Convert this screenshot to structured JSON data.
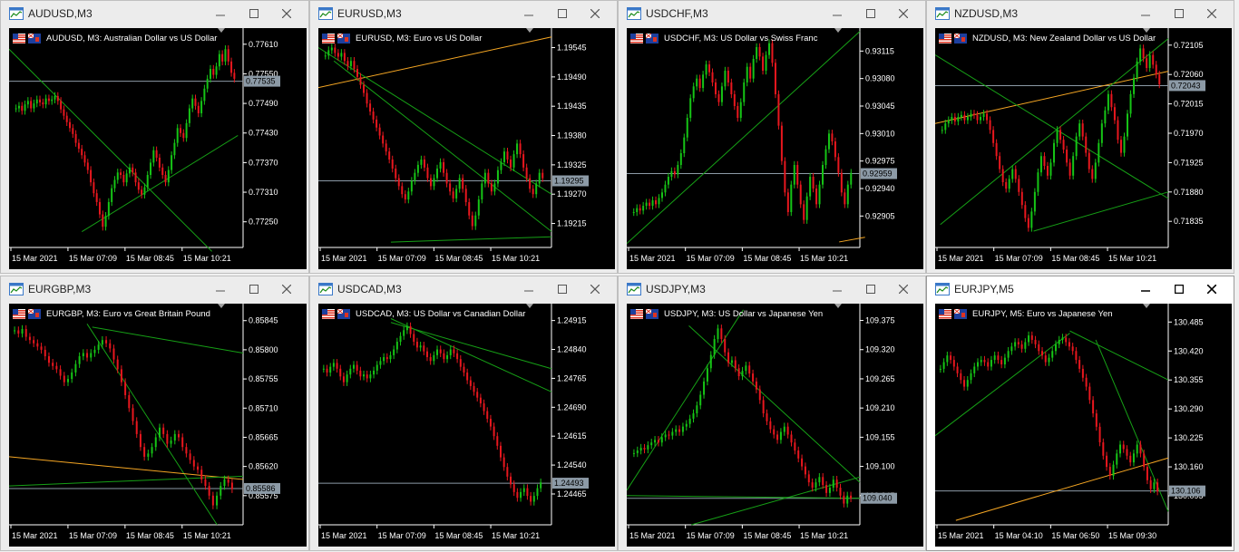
{
  "colors": {
    "bg": "#000000",
    "bull": "#16c416",
    "bear": "#e8171e",
    "trend_green": "#16a016",
    "trend_orange": "#f5a623",
    "bid_line": "#8c9aa6",
    "price_box": "#8c9aa6",
    "axis": "#ffffff"
  },
  "icons": {
    "window": "chart-window-icon",
    "minimize": "minimize-icon",
    "maximize": "maximize-icon",
    "close": "close-icon",
    "flag": "flag-icon"
  },
  "windows": [
    {
      "id": "audusd",
      "title": "AUDUSD,M3",
      "symbol_label": "AUDUSD, M3:  Australian Dollar vs US Dollar",
      "active": false,
      "y_ticks": [
        "0.77610",
        "0.77550",
        "0.77490",
        "0.77430",
        "0.77370",
        "0.77310",
        "0.77250"
      ],
      "y_top": 0.77628,
      "y_bottom": 0.77198,
      "current_price": "0.77535",
      "current_value": 0.77535,
      "x_labels": [
        "15 Mar 2021",
        "15 Mar 07:09",
        "15 Mar 08:45",
        "15 Mar 10:21"
      ],
      "series": [
        0.7748,
        0.77485,
        0.77475,
        0.77488,
        0.77495,
        0.7748,
        0.7749,
        0.77498,
        0.77492,
        0.77488,
        0.775,
        0.77495,
        0.77498,
        0.77505,
        0.77495,
        0.77478,
        0.77465,
        0.77452,
        0.7744,
        0.77428,
        0.7741,
        0.77398,
        0.77385,
        0.7737,
        0.77355,
        0.7733,
        0.77308,
        0.7729,
        0.77265,
        0.7724,
        0.77262,
        0.7729,
        0.77318,
        0.77335,
        0.7735,
        0.77345,
        0.7733,
        0.77348,
        0.7736,
        0.7735,
        0.7733,
        0.77315,
        0.77305,
        0.7732,
        0.77345,
        0.7737,
        0.77395,
        0.7738,
        0.7736,
        0.77345,
        0.7733,
        0.77355,
        0.77385,
        0.7741,
        0.7744,
        0.7743,
        0.7742,
        0.7745,
        0.7748,
        0.775,
        0.77485,
        0.7747,
        0.77495,
        0.7752,
        0.7754,
        0.7756,
        0.77548,
        0.77565,
        0.7759,
        0.77575,
        0.776,
        0.77575,
        0.77552,
        0.7754
      ],
      "trend_lines": [
        {
          "color": "green",
          "from": [
            0,
            0.776
          ],
          "to": [
            78,
            0.7719
          ]
        },
        {
          "color": "green",
          "from": [
            28,
            0.7723
          ],
          "to": [
            88,
            0.77425
          ]
        }
      ]
    },
    {
      "id": "eurusd",
      "title": "EURUSD,M3",
      "symbol_label": "EURUSD, M3:  Euro vs US Dollar",
      "active": false,
      "y_ticks": [
        "1.19545",
        "1.19490",
        "1.19435",
        "1.19380",
        "1.19325",
        "1.19270",
        "1.19215"
      ],
      "y_top": 1.19568,
      "y_bottom": 1.1917,
      "current_price": "1.19295",
      "current_value": 1.19295,
      "x_labels": [
        "15 Mar 2021",
        "15 Mar 07:09",
        "15 Mar 08:45",
        "15 Mar 10:21"
      ],
      "series": [
        1.1953,
        1.1954,
        1.19545,
        1.19535,
        1.19528,
        1.19535,
        1.1952,
        1.1951,
        1.1952,
        1.19505,
        1.1949,
        1.19475,
        1.1946,
        1.1944,
        1.19425,
        1.1941,
        1.19395,
        1.1938,
        1.19365,
        1.1935,
        1.19335,
        1.19318,
        1.193,
        1.19285,
        1.1927,
        1.1926,
        1.19275,
        1.19295,
        1.1931,
        1.19325,
        1.19335,
        1.1932,
        1.193,
        1.19285,
        1.193,
        1.19318,
        1.1933,
        1.1931,
        1.1929,
        1.19275,
        1.19262,
        1.1928,
        1.193,
        1.1928,
        1.19255,
        1.1923,
        1.1921,
        1.1923,
        1.1926,
        1.1929,
        1.1931,
        1.1929,
        1.19275,
        1.1929,
        1.19315,
        1.1933,
        1.1935,
        1.19335,
        1.1932,
        1.19345,
        1.19365,
        1.19345,
        1.1932,
        1.193,
        1.1928,
        1.1927,
        1.1929,
        1.1931,
        1.193
      ],
      "trend_lines": [
        {
          "color": "orange",
          "from": [
            0,
            1.1947
          ],
          "to": [
            90,
            1.19565
          ]
        },
        {
          "color": "green",
          "from": [
            0,
            1.19545
          ],
          "to": [
            90,
            1.1927
          ]
        },
        {
          "color": "green",
          "from": [
            6,
            1.1952
          ],
          "to": [
            90,
            1.192
          ]
        },
        {
          "color": "green",
          "from": [
            28,
            1.1918
          ],
          "to": [
            90,
            1.1919
          ]
        }
      ]
    },
    {
      "id": "usdchf",
      "title": "USDCHF,M3",
      "symbol_label": "USDCHF, M3:  US Dollar vs Swiss Franc",
      "active": false,
      "y_ticks": [
        "0.93115",
        "0.93080",
        "0.93045",
        "0.93010",
        "0.92975",
        "0.92940",
        "0.92905"
      ],
      "y_top": 0.93135,
      "y_bottom": 0.92865,
      "current_price": "0.92959",
      "current_value": 0.92959,
      "x_labels": [
        "15 Mar 2021",
        "15 Mar 07:09",
        "15 Mar 08:45",
        "15 Mar 10:21"
      ],
      "series": [
        0.9291,
        0.92915,
        0.92912,
        0.92918,
        0.92922,
        0.92918,
        0.92925,
        0.9292,
        0.92928,
        0.92935,
        0.92945,
        0.92955,
        0.92962,
        0.92958,
        0.9297,
        0.92985,
        0.93005,
        0.9303,
        0.93055,
        0.9307,
        0.9308,
        0.93068,
        0.93085,
        0.93098,
        0.93088,
        0.93075,
        0.9306,
        0.9305,
        0.9307,
        0.9309,
        0.93075,
        0.9306,
        0.93045,
        0.9303,
        0.9305,
        0.93075,
        0.93095,
        0.9308,
        0.93105,
        0.9312,
        0.93108,
        0.9309,
        0.9311,
        0.93125,
        0.931,
        0.9306,
        0.9302,
        0.92975,
        0.92935,
        0.9291,
        0.92945,
        0.9297,
        0.92945,
        0.9292,
        0.929,
        0.9293,
        0.92955,
        0.9294,
        0.9292,
        0.92945,
        0.9297,
        0.9299,
        0.9301,
        0.93,
        0.9298,
        0.9296,
        0.92935,
        0.9292,
        0.92945,
        0.9296
      ],
      "trend_lines": [
        {
          "color": "green",
          "from": [
            0,
            0.9287
          ],
          "to": [
            90,
            0.9314
          ]
        },
        {
          "color": "orange",
          "from": [
            82,
            0.92872
          ],
          "to": [
            92,
            0.92878
          ]
        }
      ]
    },
    {
      "id": "nzdusd",
      "title": "NZDUSD,M3",
      "symbol_label": "NZDUSD, M3:  New Zealand Dollar vs US Dollar",
      "active": false,
      "y_ticks": [
        "0.72105",
        "0.72060",
        "0.72015",
        "0.71970",
        "0.71925",
        "0.71880",
        "0.71835"
      ],
      "y_top": 0.7212,
      "y_bottom": 0.71795,
      "current_price": "0.72043",
      "current_value": 0.72043,
      "x_labels": [
        "15 Mar 2021",
        "15 Mar 07:09",
        "15 Mar 08:45",
        "15 Mar 10:21"
      ],
      "series": [
        0.71975,
        0.71985,
        0.7199,
        0.71995,
        0.71988,
        0.71995,
        0.71998,
        0.7199,
        0.71995,
        0.72,
        0.71998,
        0.7199,
        0.71995,
        0.72,
        0.7199,
        0.71975,
        0.71955,
        0.71935,
        0.71915,
        0.71895,
        0.71885,
        0.719,
        0.71915,
        0.719,
        0.7188,
        0.7186,
        0.7184,
        0.71825,
        0.7185,
        0.7188,
        0.7191,
        0.71935,
        0.7192,
        0.71905,
        0.71925,
        0.71955,
        0.71975,
        0.7196,
        0.71945,
        0.71925,
        0.71905,
        0.71935,
        0.71965,
        0.71985,
        0.71965,
        0.7194,
        0.71915,
        0.719,
        0.71925,
        0.71955,
        0.71985,
        0.72005,
        0.7203,
        0.7201,
        0.7199,
        0.7196,
        0.7194,
        0.71965,
        0.72,
        0.7203,
        0.72055,
        0.7208,
        0.721,
        0.72085,
        0.7207,
        0.7209,
        0.72075,
        0.7206,
        0.72045
      ],
      "trend_lines": [
        {
          "color": "orange",
          "from": [
            0,
            0.71985
          ],
          "to": [
            90,
            0.72065
          ]
        },
        {
          "color": "green",
          "from": [
            0,
            0.7209
          ],
          "to": [
            90,
            0.7187
          ]
        },
        {
          "color": "green",
          "from": [
            38,
            0.7182
          ],
          "to": [
            90,
            0.7188
          ]
        },
        {
          "color": "green",
          "from": [
            2,
            0.7183
          ],
          "to": [
            90,
            0.72115
          ]
        }
      ]
    },
    {
      "id": "eurgbp",
      "title": "EURGBP,M3",
      "symbol_label": "EURGBP, M3:  Euro vs Great Britain Pound",
      "active": false,
      "y_ticks": [
        "0.85845",
        "0.85800",
        "0.85755",
        "0.85710",
        "0.85665",
        "0.85620",
        "0.85575"
      ],
      "y_top": 0.8586,
      "y_bottom": 0.8553,
      "current_price": "0.85586",
      "current_value": 0.85586,
      "x_labels": [
        "15 Mar 2021",
        "15 Mar 07:09",
        "15 Mar 08:45",
        "15 Mar 10:21"
      ],
      "series": [
        0.8583,
        0.85825,
        0.85832,
        0.8582,
        0.85815,
        0.8581,
        0.85805,
        0.858,
        0.8579,
        0.8578,
        0.85775,
        0.8577,
        0.8576,
        0.8575,
        0.85755,
        0.85765,
        0.85778,
        0.8579,
        0.85795,
        0.85788,
        0.85795,
        0.858,
        0.85808,
        0.85815,
        0.8581,
        0.85802,
        0.85785,
        0.8577,
        0.8575,
        0.8573,
        0.8571,
        0.8569,
        0.8567,
        0.8565,
        0.85635,
        0.8564,
        0.8565,
        0.85665,
        0.8568,
        0.8567,
        0.85655,
        0.8566,
        0.8567,
        0.85665,
        0.8565,
        0.8564,
        0.8563,
        0.8562,
        0.85615,
        0.856,
        0.8559,
        0.85575,
        0.8556,
        0.85575,
        0.8559,
        0.856,
        0.85595,
        0.85585
      ],
      "trend_lines": [
        {
          "color": "green",
          "from": [
            32,
            0.85835
          ],
          "to": [
            90,
            0.85795
          ]
        },
        {
          "color": "green",
          "from": [
            30,
            0.8584
          ],
          "to": [
            80,
            0.8553
          ]
        },
        {
          "color": "orange",
          "from": [
            0,
            0.85635
          ],
          "to": [
            90,
            0.856
          ]
        },
        {
          "color": "green",
          "from": [
            0,
            0.8559
          ],
          "to": [
            90,
            0.85605
          ]
        }
      ]
    },
    {
      "id": "usdcad",
      "title": "USDCAD,M3",
      "symbol_label": "USDCAD, M3:  US Dollar vs Canadian Dollar",
      "active": false,
      "y_ticks": [
        "1.24915",
        "1.24840",
        "1.24765",
        "1.24690",
        "1.24615",
        "1.24540",
        "1.24465"
      ],
      "y_top": 1.2494,
      "y_bottom": 1.24385,
      "current_price": "1.24493",
      "current_value": 1.24493,
      "x_labels": [
        "15 Mar 2021",
        "15 Mar 07:09",
        "15 Mar 08:45",
        "15 Mar 10:21"
      ],
      "series": [
        1.2479,
        1.2478,
        1.24795,
        1.24805,
        1.2479,
        1.2477,
        1.24755,
        1.24775,
        1.2479,
        1.248,
        1.24785,
        1.2477,
        1.24775,
        1.24765,
        1.24775,
        1.24785,
        1.248,
        1.2481,
        1.2482,
        1.24815,
        1.24825,
        1.2484,
        1.2486,
        1.24875,
        1.2489,
        1.249,
        1.2488,
        1.2486,
        1.24845,
        1.2485,
        1.24835,
        1.2482,
        1.2481,
        1.24825,
        1.2484,
        1.2483,
        1.24815,
        1.24825,
        1.2484,
        1.2483,
        1.24815,
        1.24795,
        1.2478,
        1.2476,
        1.24745,
        1.2473,
        1.24715,
        1.247,
        1.2468,
        1.2466,
        1.2464,
        1.24615,
        1.2459,
        1.2456,
        1.24535,
        1.2451,
        1.2449,
        1.2447,
        1.24455,
        1.2447,
        1.2448,
        1.2446,
        1.24445,
        1.2446,
        1.2448,
        1.24495
      ],
      "trend_lines": [
        {
          "color": "green",
          "from": [
            28,
            1.2492
          ],
          "to": [
            90,
            1.2473
          ]
        },
        {
          "color": "green",
          "from": [
            28,
            1.2491
          ],
          "to": [
            90,
            1.2479
          ]
        }
      ]
    },
    {
      "id": "usdjpy",
      "title": "USDJPY,M3",
      "symbol_label": "USDJPY, M3:  US Dollar vs Japanese Yen",
      "active": false,
      "y_ticks": [
        "109.375",
        "109.320",
        "109.265",
        "109.210",
        "109.155",
        "109.100",
        "109.045"
      ],
      "y_top": 109.393,
      "y_bottom": 108.99,
      "current_price": "109.040",
      "current_value": 109.04,
      "x_labels": [
        "15 Mar 2021",
        "15 Mar 07:09",
        "15 Mar 08:45",
        "15 Mar 10:21"
      ],
      "series": [
        109.125,
        109.13,
        109.135,
        109.132,
        109.14,
        109.145,
        109.15,
        109.145,
        109.155,
        109.16,
        109.158,
        109.165,
        109.17,
        109.165,
        109.175,
        109.18,
        109.19,
        109.2,
        109.215,
        109.235,
        109.26,
        109.285,
        109.31,
        109.34,
        109.36,
        109.34,
        109.315,
        109.295,
        109.3,
        109.285,
        109.27,
        109.28,
        109.29,
        109.275,
        109.26,
        109.245,
        109.225,
        109.2,
        109.185,
        109.17,
        109.16,
        109.15,
        109.165,
        109.175,
        109.16,
        109.145,
        109.13,
        109.115,
        109.1,
        109.085,
        109.07,
        109.06,
        109.07,
        109.08,
        109.065,
        109.05,
        109.06,
        109.075,
        109.06,
        109.045,
        109.03,
        109.045,
        109.04
      ],
      "trend_lines": [
        {
          "color": "green",
          "from": [
            0,
            109.055
          ],
          "to": [
            45,
            109.395
          ]
        },
        {
          "color": "green",
          "from": [
            24,
            109.365
          ],
          "to": [
            90,
            109.07
          ]
        },
        {
          "color": "green",
          "from": [
            25,
            108.99
          ],
          "to": [
            90,
            109.08
          ]
        },
        {
          "color": "green",
          "from": [
            0,
            109.045
          ],
          "to": [
            90,
            109.04
          ]
        }
      ]
    },
    {
      "id": "eurjpy",
      "title": "EURJPY,M5",
      "symbol_label": "EURJPY, M5:  Euro vs Japanese Yen",
      "active": true,
      "y_ticks": [
        "130.485",
        "130.420",
        "130.355",
        "130.290",
        "130.225",
        "130.160",
        "130.095"
      ],
      "y_top": 130.51,
      "y_bottom": 130.03,
      "current_price": "130.106",
      "current_value": 130.106,
      "x_labels": [
        "15 Mar 2021",
        "15 Mar 04:10",
        "15 Mar 06:50",
        "15 Mar 09:30"
      ],
      "series": [
        130.38,
        130.395,
        130.41,
        130.4,
        130.385,
        130.37,
        130.355,
        130.34,
        130.355,
        130.37,
        130.385,
        130.395,
        130.4,
        130.395,
        130.385,
        130.4,
        130.41,
        130.4,
        130.39,
        130.405,
        130.42,
        130.43,
        130.44,
        130.435,
        130.425,
        130.44,
        130.455,
        130.445,
        130.435,
        130.42,
        130.41,
        130.395,
        130.405,
        130.42,
        130.435,
        130.445,
        130.45,
        130.44,
        130.43,
        130.42,
        130.4,
        130.38,
        130.36,
        130.34,
        130.31,
        130.28,
        130.25,
        130.215,
        130.185,
        130.16,
        130.14,
        130.165,
        130.19,
        130.21,
        130.2,
        130.185,
        130.17,
        130.19,
        130.21,
        130.19,
        130.16,
        130.13,
        130.11,
        130.125,
        130.105
      ],
      "trend_lines": [
        {
          "color": "green",
          "from": [
            0,
            130.23
          ],
          "to": [
            52,
            130.46
          ]
        },
        {
          "color": "green",
          "from": [
            52,
            130.465
          ],
          "to": [
            90,
            130.355
          ]
        },
        {
          "color": "green",
          "from": [
            62,
            130.445
          ],
          "to": [
            90,
            130.06
          ]
        },
        {
          "color": "orange",
          "from": [
            8,
            130.04
          ],
          "to": [
            90,
            130.18
          ]
        }
      ]
    }
  ]
}
